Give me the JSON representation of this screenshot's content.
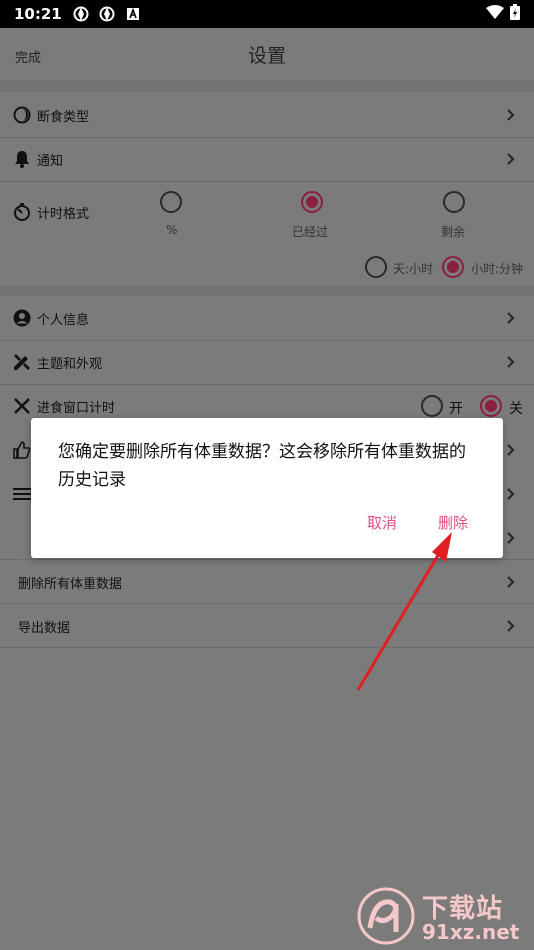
{
  "status_bar": {
    "time": "10:21"
  },
  "header": {
    "done_label": "完成",
    "title": "设置"
  },
  "settings": {
    "fasting_type": "断食类型",
    "notifications": "通知",
    "timer_format": {
      "label": "计时格式",
      "options": [
        "%",
        "已经过",
        "剩余"
      ],
      "selected": "已经过",
      "unit_options": [
        "天:小时",
        "小时:分钟"
      ],
      "unit_selected": "小时:分钟"
    },
    "personal_info": "个人信息",
    "theme": "主题和外观",
    "eating_window": {
      "label": "进食窗口计时",
      "on_label": "开",
      "off_label": "关",
      "selected": "关"
    },
    "delete_all_weight": "删除所有体重数据",
    "export_data": "导出数据"
  },
  "dialog": {
    "message": "您确定要删除所有体重数据？这会移除所有体重数据的历史记录",
    "cancel_label": "取消",
    "delete_label": "删除"
  },
  "watermark": {
    "text": "下载站",
    "url": "91xz.net"
  },
  "colors": {
    "accent": "#8a1f3e",
    "dialog_button": "#e0507f",
    "arrow": "#e02020"
  }
}
